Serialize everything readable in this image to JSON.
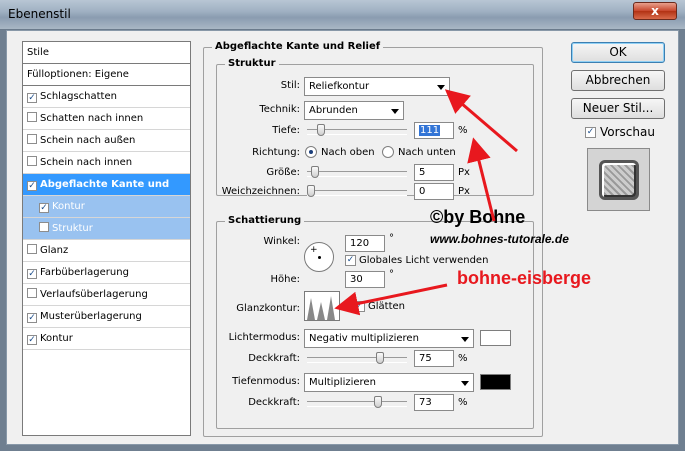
{
  "window": {
    "title": "Ebenenstil",
    "close_label": "x"
  },
  "style_list": {
    "header": "Stile",
    "fill_options": "Fülloptionen: Eigene",
    "items": [
      {
        "label": "Schlagschatten",
        "checked": true
      },
      {
        "label": "Schatten nach innen",
        "checked": false
      },
      {
        "label": "Schein nach außen",
        "checked": false
      },
      {
        "label": "Schein nach innen",
        "checked": false
      },
      {
        "label": "Abgeflachte Kante und Relief",
        "checked": true
      },
      {
        "label": "Kontur",
        "checked": true
      },
      {
        "label": "Struktur",
        "checked": false
      },
      {
        "label": "Glanz",
        "checked": false
      },
      {
        "label": "Farbüberlagerung",
        "checked": true
      },
      {
        "label": "Verlaufsüberlagerung",
        "checked": false
      },
      {
        "label": "Musterüberlagerung",
        "checked": true
      },
      {
        "label": "Kontur",
        "checked": true
      }
    ],
    "check_mark": "✓"
  },
  "panel": {
    "title": "Abgeflachte Kante und Relief",
    "structure": {
      "title": "Struktur",
      "style_label": "Stil:",
      "style_value": "Reliefkontur",
      "technique_label": "Technik:",
      "technique_value": "Abrunden",
      "depth_label": "Tiefe:",
      "depth_value": "111",
      "depth_unit": "%",
      "depth_level": 0.11,
      "direction_label": "Richtung:",
      "direction_up": "Nach oben",
      "direction_down": "Nach unten",
      "size_label": "Größe:",
      "size_value": "5",
      "size_unit": "Px",
      "size_level": 0.04,
      "soften_label": "Weichzeichnen:",
      "soften_value": "0",
      "soften_unit": "Px",
      "soften_level": 0.0
    },
    "shading": {
      "title": "Schattierung",
      "angle_label": "Winkel:",
      "angle_value": "120",
      "angle_unit": "°",
      "global_light_label": "Globales Licht verwenden",
      "altitude_label": "Höhe:",
      "altitude_value": "30",
      "altitude_unit": "°",
      "gloss_contour_label": "Glanzkontur:",
      "antialias_label": "Glätten",
      "highlight_mode_label": "Lichtermodus:",
      "highlight_mode_value": "Negativ multiplizieren",
      "highlight_color": "#ffffff",
      "highlight_opacity_label": "Deckkraft:",
      "highlight_opacity_value": "75",
      "highlight_opacity_level": 0.75,
      "shadow_mode_label": "Tiefenmodus:",
      "shadow_mode_value": "Multiplizieren",
      "shadow_color": "#000000",
      "shadow_opacity_label": "Deckkraft:",
      "shadow_opacity_value": "73",
      "shadow_opacity_level": 0.73,
      "percent": "%"
    }
  },
  "buttons": {
    "ok": "OK",
    "cancel": "Abbrechen",
    "new_style": "Neuer Stil...",
    "preview_label": "Vorschau"
  },
  "annotations": {
    "copyright": "©by Bohne",
    "url": "www.bohnes-tutorale.de",
    "contour_name": "bohne-eisberge",
    "contour_name_color": "#e8181e",
    "arrow_color": "#e8181e"
  }
}
